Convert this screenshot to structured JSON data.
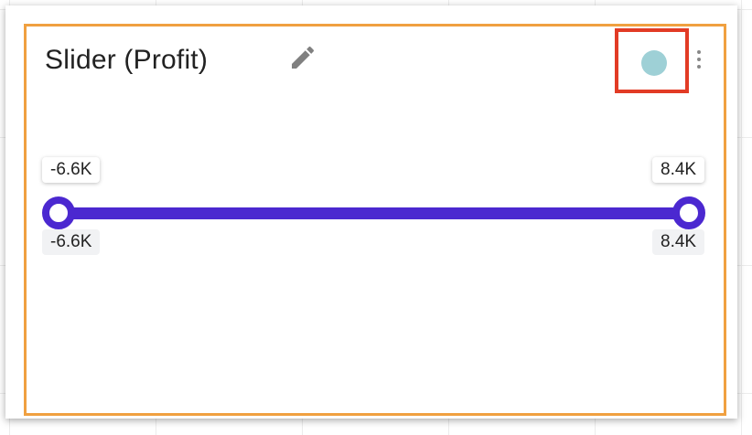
{
  "widget": {
    "title": "Slider (Profit)",
    "accent_color": "#f0a040",
    "slider_color": "#4b28d0",
    "swatch_color": "#9ed0d6",
    "highlight_color": "#e23b25"
  },
  "slider": {
    "min_label_top": "-6.6K",
    "max_label_top": "8.4K",
    "min_label_bottom": "-6.6K",
    "max_label_bottom": "8.4K",
    "selected_min_fraction": 0,
    "selected_max_fraction": 1
  },
  "icons": {
    "edit": "pencil-icon",
    "color": "color-swatch-icon",
    "menu": "more-vertical-icon"
  }
}
